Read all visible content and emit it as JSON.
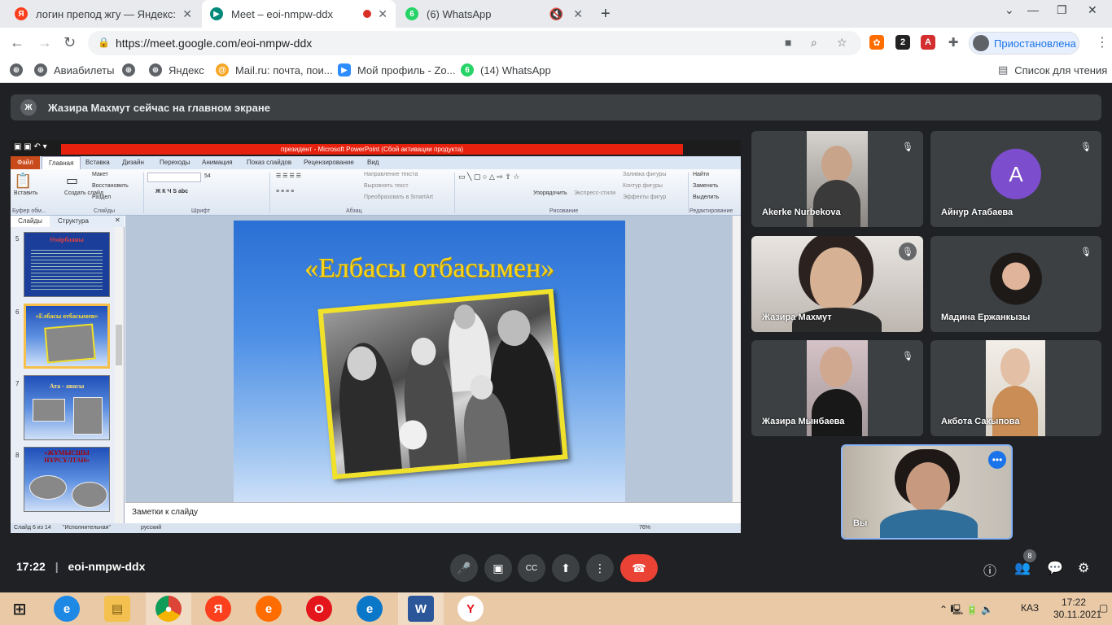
{
  "browser": {
    "tabs": [
      {
        "title": "логин препод жгу — Яндекс: на",
        "icon": "yandex-icon",
        "active": false
      },
      {
        "title": "Meet – eoi-nmpw-ddx",
        "icon": "meet-icon",
        "active": true,
        "recording": true
      },
      {
        "title": "(6) WhatsApp",
        "icon": "whatsapp-icon",
        "active": false,
        "muted": true
      }
    ],
    "url": "https://meet.google.com/eoi-nmpw-ddx",
    "profile_label": "Приостановлена",
    "ext_badge": "2",
    "bookmarks": [
      {
        "label": "Авиабилеты",
        "icon": "globe-icon"
      },
      {
        "label": "Яндекс",
        "icon": "globe-icon"
      },
      {
        "label": "Mail.ru: почта, пои...",
        "icon": "mailru-icon"
      },
      {
        "label": "Мой профиль - Zo...",
        "icon": "zoom-icon"
      },
      {
        "label": "(14) WhatsApp",
        "icon": "whatsapp-icon"
      }
    ],
    "reading_list": "Список для чтения"
  },
  "meet": {
    "banner_initial": "Ж",
    "banner_text": "Жазира Махмут сейчас на главном экране",
    "time": "17:22",
    "meeting_code": "eoi-nmpw-ddx",
    "participants_count": "8",
    "participants": [
      {
        "name": "Akerke Nurbekova",
        "muted": true,
        "video": true
      },
      {
        "name": "Айнур Атабаева",
        "muted": true,
        "video": false,
        "initial": "A",
        "avatar_color": "#7c4dcc"
      },
      {
        "name": "Жазира Махмут",
        "muted": true,
        "video": true
      },
      {
        "name": "Мадина Ержанкызы",
        "muted": true,
        "video": true
      },
      {
        "name": "Жазира Мынбаева",
        "muted": true,
        "video": true
      },
      {
        "name": "Акбота Сакыпова",
        "muted": false,
        "video": true
      },
      {
        "name": "Вы",
        "muted": false,
        "video": true,
        "self": true
      }
    ]
  },
  "ppt": {
    "title": "президент - Microsoft PowerPoint (Сбой активации продукта)",
    "tabs": [
      "Файл",
      "Главная",
      "Вставка",
      "Дизайн",
      "Переходы",
      "Анимация",
      "Показ слайдов",
      "Рецензирование",
      "Вид"
    ],
    "ribbon": {
      "paste": "Вставить",
      "new_slide": "Создать слайд",
      "layout": "Макет",
      "reset": "Восстановить",
      "section": "Раздел",
      "font_size": "54",
      "text_dir": "Направление текста",
      "align_text": "Выровнять текст",
      "smartart": "Преобразовать в SmartArt",
      "arrange": "Упорядочить",
      "quick_styles": "Экспресс-стили",
      "shape_fill": "Заливка фигуры",
      "shape_outline": "Контур фигуры",
      "shape_effects": "Эффекты фигур",
      "find": "Найти",
      "replace": "Заменить",
      "select": "Выделить",
      "groups": [
        "Буфер обм...",
        "Слайды",
        "Шрифт",
        "Абзац",
        "Рисование",
        "Редактирование"
      ]
    },
    "panel_tabs": [
      "Слайды",
      "Структура"
    ],
    "slides": [
      {
        "num": "5",
        "title": "Өмірбаяны"
      },
      {
        "num": "6",
        "title": "«Елбасы отбасымен»",
        "selected": true
      },
      {
        "num": "7",
        "title": "Ата - анасы"
      },
      {
        "num": "8",
        "title": "«ЖҰМЫСШЫ НҰРСҰЛТАН»"
      }
    ],
    "current_slide_title": "«Елбасы отбасымен»",
    "notes_placeholder": "Заметки к слайду",
    "status": {
      "slide_info": "Слайд 6 из 14",
      "theme": "\"Исполнительная\"",
      "language": "русский",
      "zoom": "76%"
    }
  },
  "taskbar": {
    "lang": "КАЗ",
    "time": "17:22",
    "date": "30.11.2021"
  },
  "colors": {
    "meet_bg": "#202124",
    "tile_bg": "#3c4043",
    "end_call": "#ea4335",
    "accent": "#1a73e8",
    "slide_title": "#f7d61d"
  }
}
